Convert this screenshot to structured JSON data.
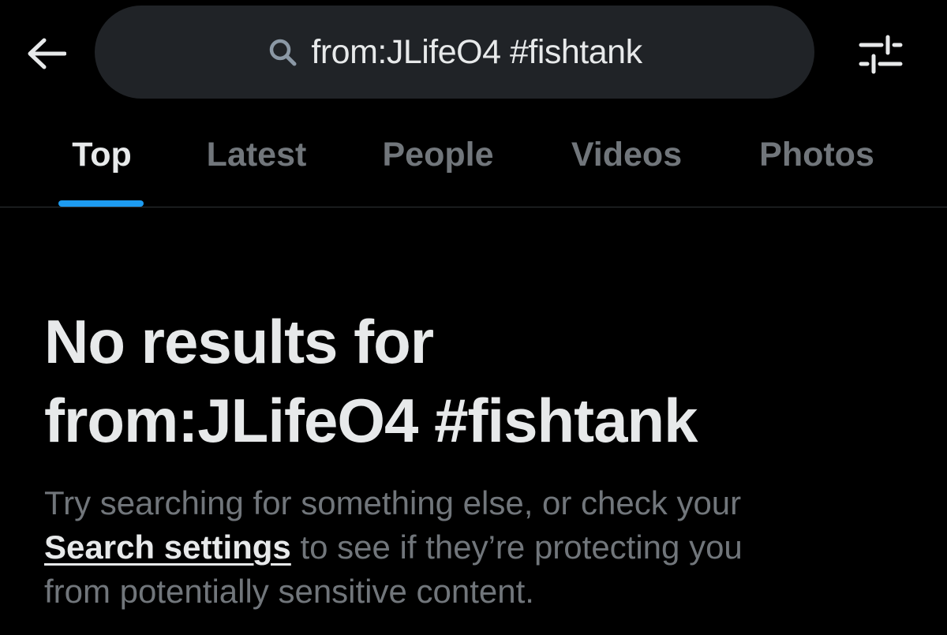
{
  "header": {
    "back_icon": "arrow-left-icon",
    "search_icon": "search-icon",
    "search_query": "from:JLifeO4 #fishtank",
    "filter_icon": "filter-sliders-icon"
  },
  "tabs": [
    {
      "label": "Top",
      "active": true
    },
    {
      "label": "Latest",
      "active": false
    },
    {
      "label": "People",
      "active": false
    },
    {
      "label": "Videos",
      "active": false
    },
    {
      "label": "Photos",
      "active": false
    }
  ],
  "empty_state": {
    "title_line1": "No results for",
    "title_line2": "from:JLifeO4 #fishtank",
    "desc_part1": "Try searching for something else, or check your",
    "link_text": "Search settings",
    "desc_part2": " to see if they’re protecting you",
    "desc_part3": "from potentially sensitive content."
  },
  "colors": {
    "background": "#000000",
    "search_pill": "#202327",
    "primary_text": "#e7e9ea",
    "secondary_text": "#71767b",
    "accent": "#1d9bf0",
    "divider": "#2f3336"
  }
}
